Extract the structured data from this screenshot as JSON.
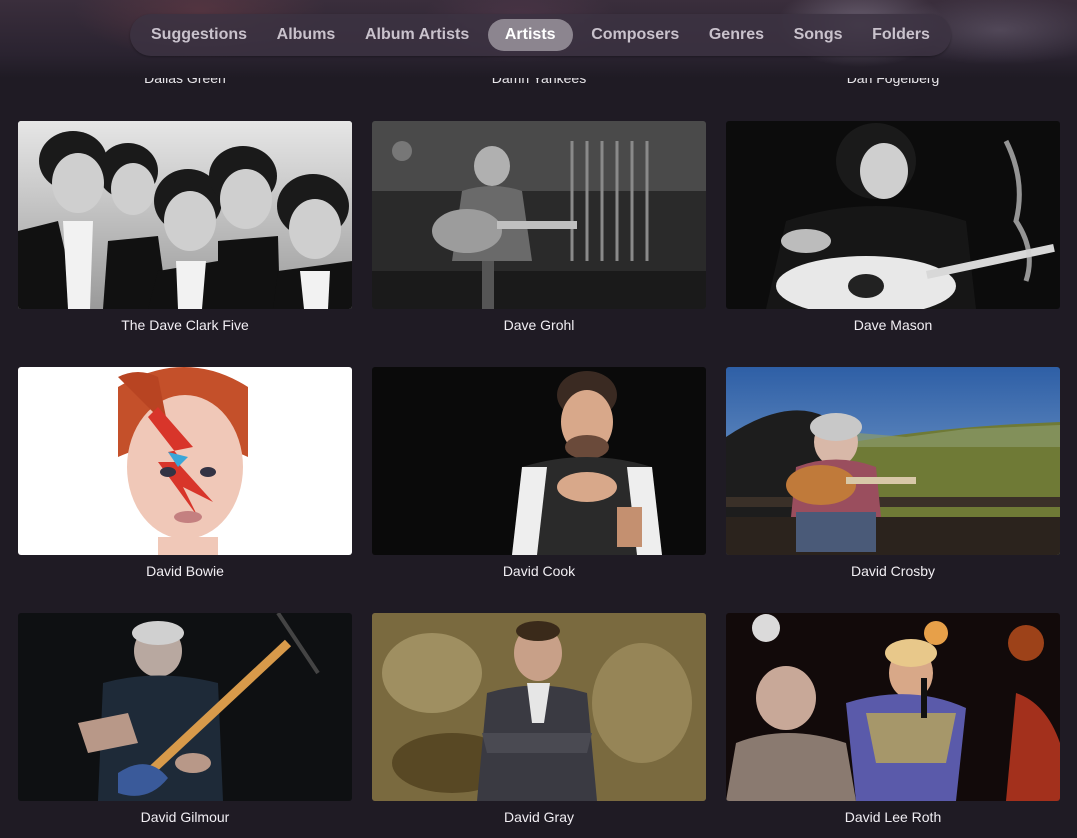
{
  "tabs": [
    {
      "label": "Suggestions",
      "active": false
    },
    {
      "label": "Albums",
      "active": false
    },
    {
      "label": "Album Artists",
      "active": false
    },
    {
      "label": "Artists",
      "active": true
    },
    {
      "label": "Composers",
      "active": false
    },
    {
      "label": "Genres",
      "active": false
    },
    {
      "label": "Songs",
      "active": false
    },
    {
      "label": "Folders",
      "active": false
    }
  ],
  "top_row": [
    "Dallas Green",
    "Damn Yankees",
    "Dan Fogelberg"
  ],
  "artists": [
    {
      "name": "The Dave Clark Five"
    },
    {
      "name": "Dave Grohl"
    },
    {
      "name": "Dave Mason"
    },
    {
      "name": "David Bowie"
    },
    {
      "name": "David Cook"
    },
    {
      "name": "David Crosby"
    },
    {
      "name": "David Gilmour"
    },
    {
      "name": "David Gray"
    },
    {
      "name": "David Lee Roth"
    }
  ]
}
